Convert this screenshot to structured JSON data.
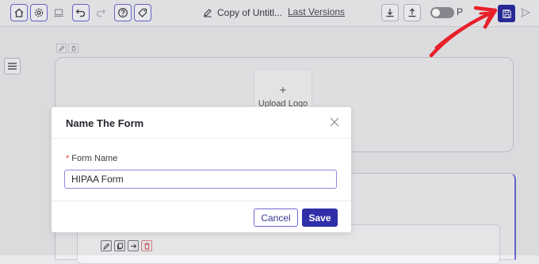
{
  "toolbar": {
    "icons": [
      "home-icon",
      "settings-icon",
      "preview-icon",
      "undo-icon",
      "redo-icon",
      "help-icon",
      "tag-icon"
    ],
    "form_title": "Copy of Untitl...",
    "last_versions": "Last Versions",
    "right_icons": [
      "download-icon",
      "upload-icon",
      "save-icon",
      "send-icon"
    ],
    "toggle_label": "P",
    "toggle_on": false
  },
  "canvas": {
    "upload_plus": "+",
    "upload_logo": "Upload Logo"
  },
  "dialog": {
    "title": "Name The Form",
    "required_mark": "*",
    "field_label": "Form Name",
    "field_value": "HIPAA Form",
    "cancel_label": "Cancel",
    "save_label": "Save"
  },
  "colors": {
    "accent": "#2f2fa8",
    "annotation_arrow": "#e8202a",
    "required": "#e0453a"
  }
}
